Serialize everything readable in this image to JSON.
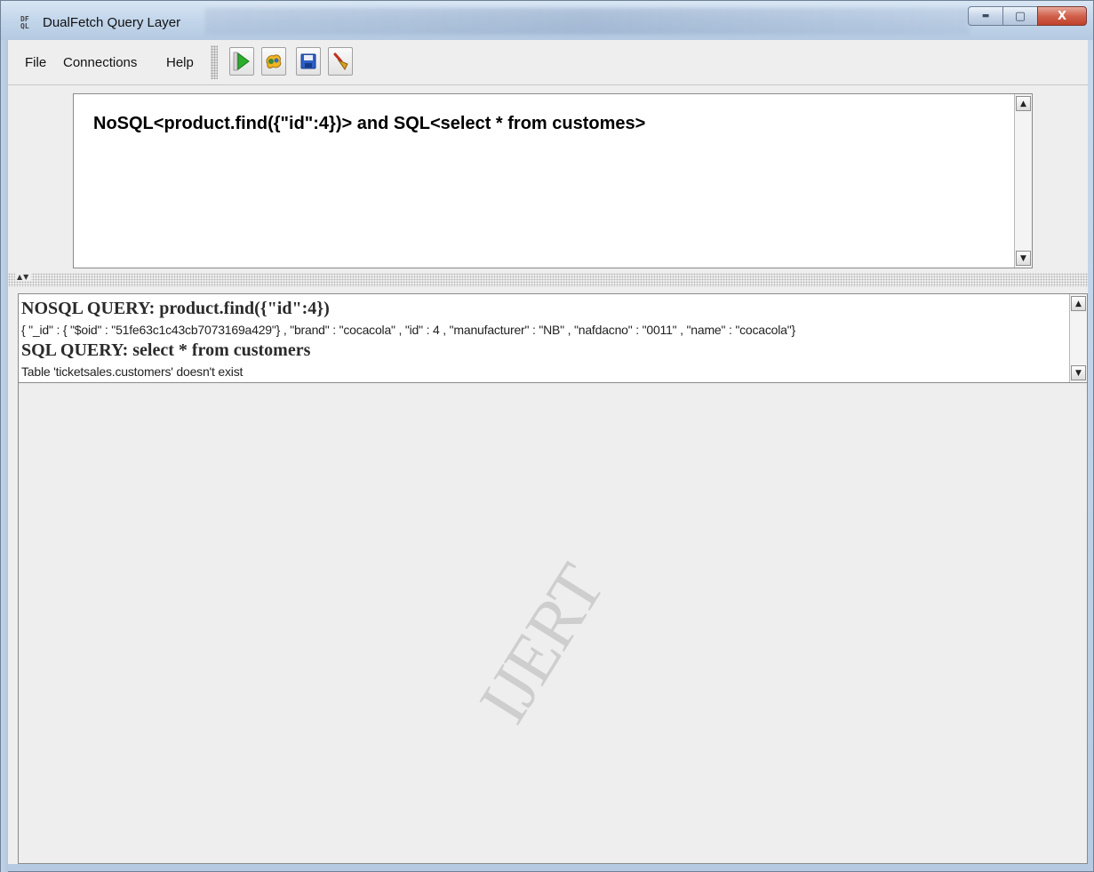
{
  "window": {
    "app_icon_text": "DF QL",
    "title": "DualFetch Query Layer",
    "minimize_glyph": "▬",
    "maximize_glyph": "▢",
    "close_glyph": "X"
  },
  "menu": {
    "items": [
      "File",
      "Connections",
      "Help"
    ]
  },
  "toolbar": {
    "buttons": [
      {
        "icon": "run-icon",
        "color": "#2cae2c"
      },
      {
        "icon": "connect-icon",
        "color": "#f0b423"
      },
      {
        "icon": "save-icon",
        "color": "#2d5fc8"
      },
      {
        "icon": "clear-icon",
        "color": "#d9a020"
      }
    ]
  },
  "query_editor": {
    "text": "NoSQL<product.find({\"id\":4})> and SQL<select * from customes>"
  },
  "results": {
    "nosql_heading": "NOSQL QUERY: product.find({\"id\":4})",
    "nosql_result": "{ \"_id\" : { \"$oid\" : \"51fe63c1c43cb7073169a429\"} , \"brand\" : \"cocacola\" , \"id\" : 4 , \"manufacturer\" : \"NB\" , \"nafdacno\" : \"0011\" , \"name\" : \"cocacola\"}",
    "sql_heading": "SQL QUERY: select * from customers",
    "sql_result": "Table 'ticketsales.customers' doesn't exist"
  },
  "watermark": "IJERT"
}
